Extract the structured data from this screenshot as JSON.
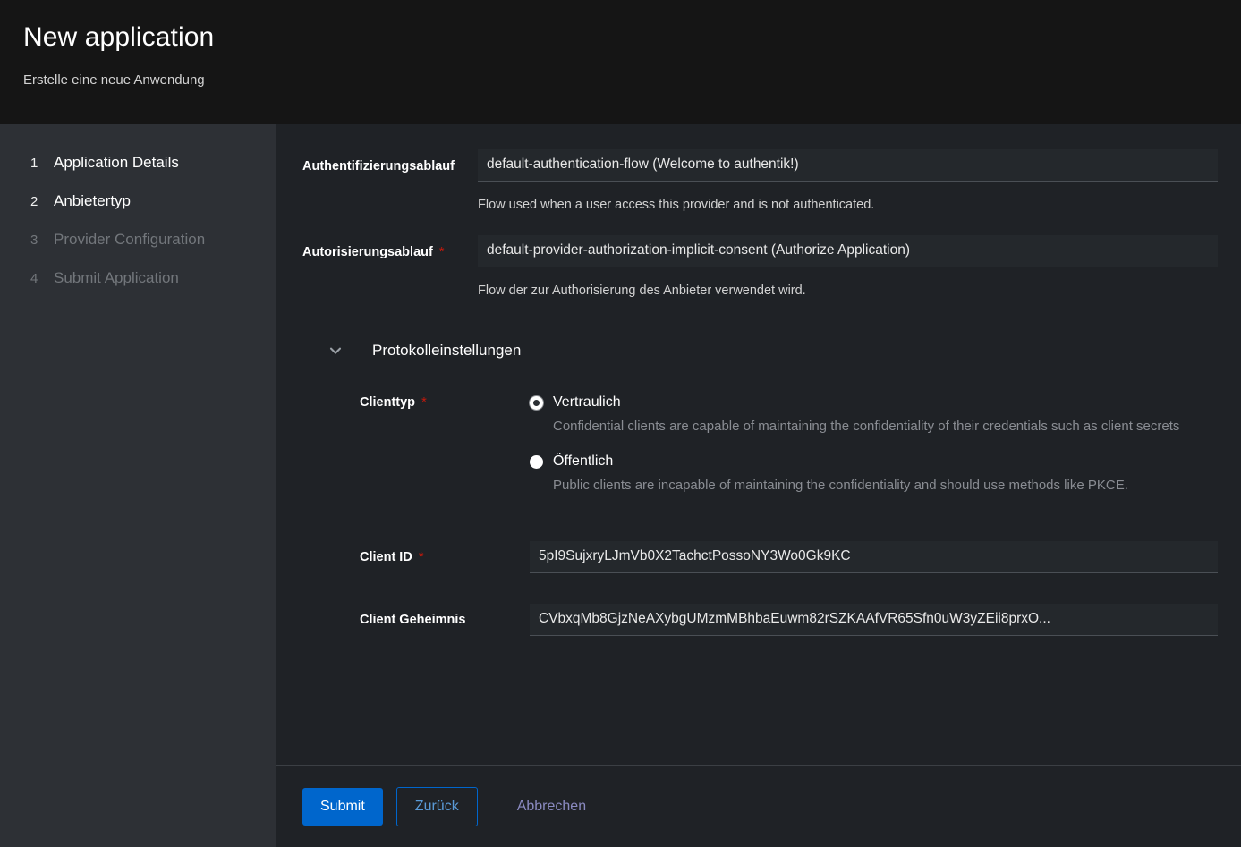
{
  "header": {
    "title": "New application",
    "subtitle": "Erstelle eine neue Anwendung"
  },
  "sidebar": {
    "steps": [
      {
        "num": "1",
        "label": "Application Details",
        "state": "done"
      },
      {
        "num": "2",
        "label": "Anbietertyp",
        "state": "active"
      },
      {
        "num": "3",
        "label": "Provider Configuration",
        "state": "disabled"
      },
      {
        "num": "4",
        "label": "Submit Application",
        "state": "disabled"
      }
    ]
  },
  "form": {
    "auth_flow": {
      "label": "Authentifizierungsablauf",
      "value": "default-authentication-flow (Welcome to authentik!)",
      "help": "Flow used when a user access this provider and is not authenticated."
    },
    "authz_flow": {
      "label": "Autorisierungsablauf",
      "required_marker": "*",
      "value": "default-provider-authorization-implicit-consent (Authorize Application)",
      "help": "Flow der zur Authorisierung des Anbieter verwendet wird."
    },
    "protocol_section": {
      "title": "Protokolleinstellungen",
      "chevron": "chevron-down-icon",
      "expanded": true
    },
    "client_type": {
      "label": "Clienttyp",
      "required_marker": "*",
      "options": [
        {
          "label": "Vertraulich",
          "selected": true,
          "description": "Confidential clients are capable of maintaining the confidentiality of their credentials such as client secrets"
        },
        {
          "label": "Öffentlich",
          "selected": false,
          "description": "Public clients are incapable of maintaining the confidentiality and should use methods like PKCE."
        }
      ]
    },
    "client_id": {
      "label": "Client ID",
      "required_marker": "*",
      "value": "5pI9SujxryLJmVb0X2TachctPossoNY3Wo0Gk9KC"
    },
    "client_secret": {
      "label": "Client Geheimnis",
      "value": "CVbxqMb8GjzNeAXybgUMzmMBhbaEuwm82rSZKAAfVR65Sfn0uW3yZEii8prxO..."
    }
  },
  "footer": {
    "submit_label": "Submit",
    "back_label": "Zurück",
    "cancel_label": "Abbrechen"
  },
  "colors": {
    "primary": "#0066cc",
    "required": "#c9190b",
    "header_bg": "#151515",
    "sidebar_bg": "#2d3035",
    "main_bg": "#1f2226"
  }
}
